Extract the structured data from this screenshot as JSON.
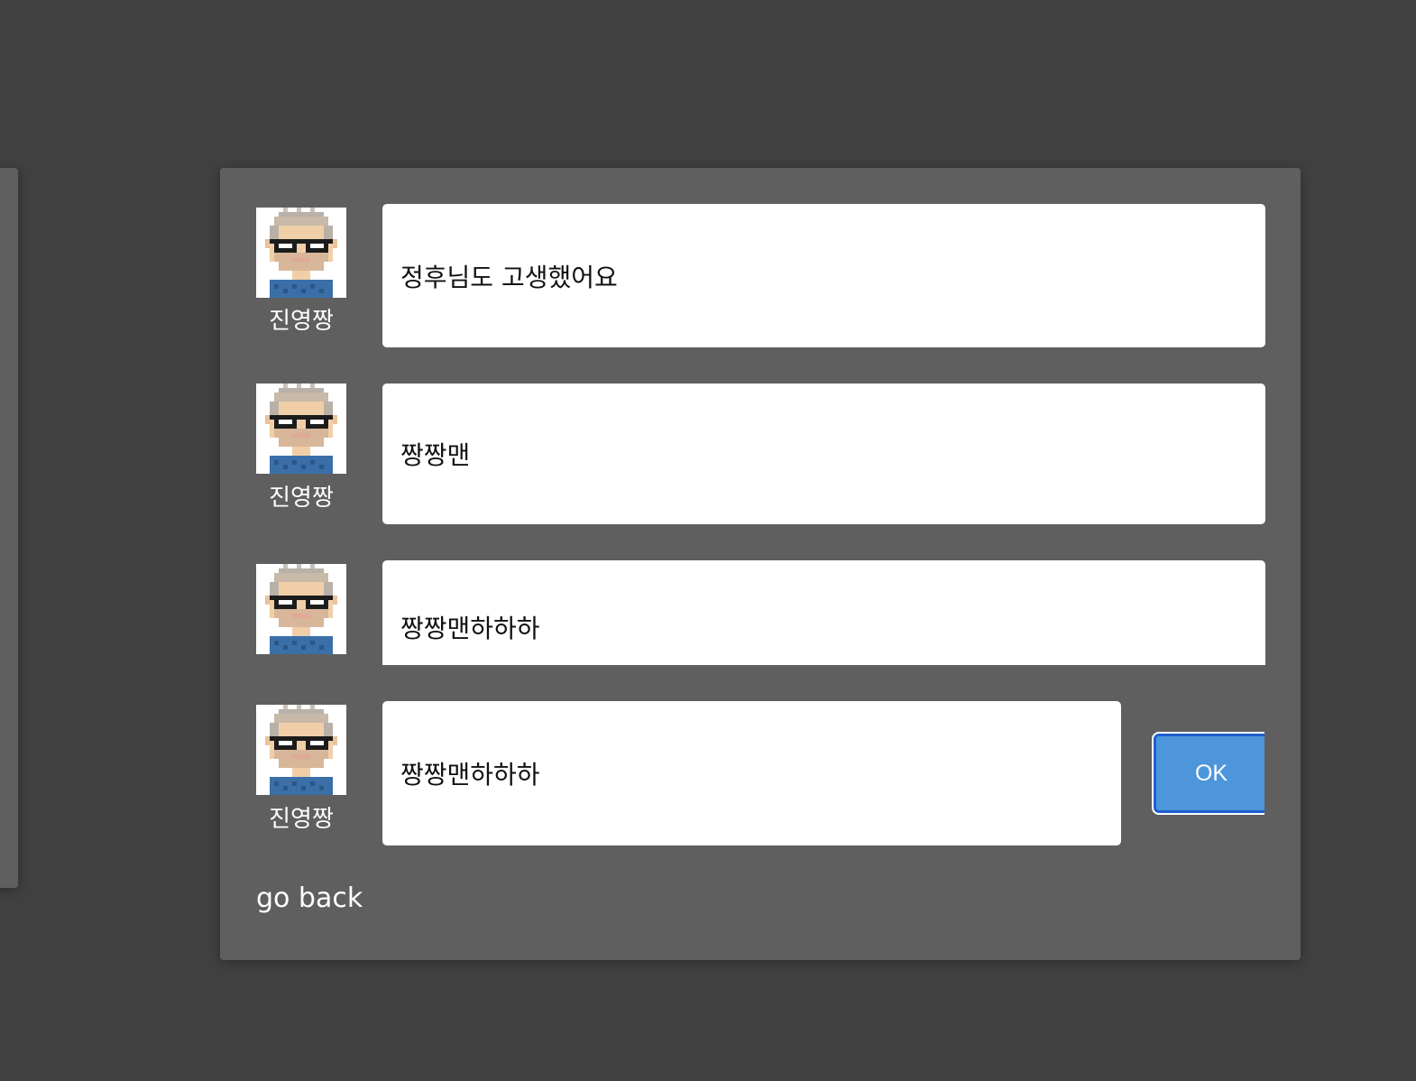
{
  "messages": [
    {
      "author": "진영짱",
      "text": "정후님도 고생했어요"
    },
    {
      "author": "진영짱",
      "text": "짱짱맨"
    },
    {
      "author": "",
      "text": "짱짱맨하하하"
    }
  ],
  "compose": {
    "author": "진영짱",
    "value": "짱짱맨하하하",
    "ok_label": "OK"
  },
  "go_back_label": "go back",
  "colors": {
    "background": "#414141",
    "dialog": "#5f5f5f",
    "ok_button": "#4d96db",
    "ok_border": "#1f5fd0"
  },
  "icons": {
    "avatar": "pixel-avatar-icon"
  }
}
